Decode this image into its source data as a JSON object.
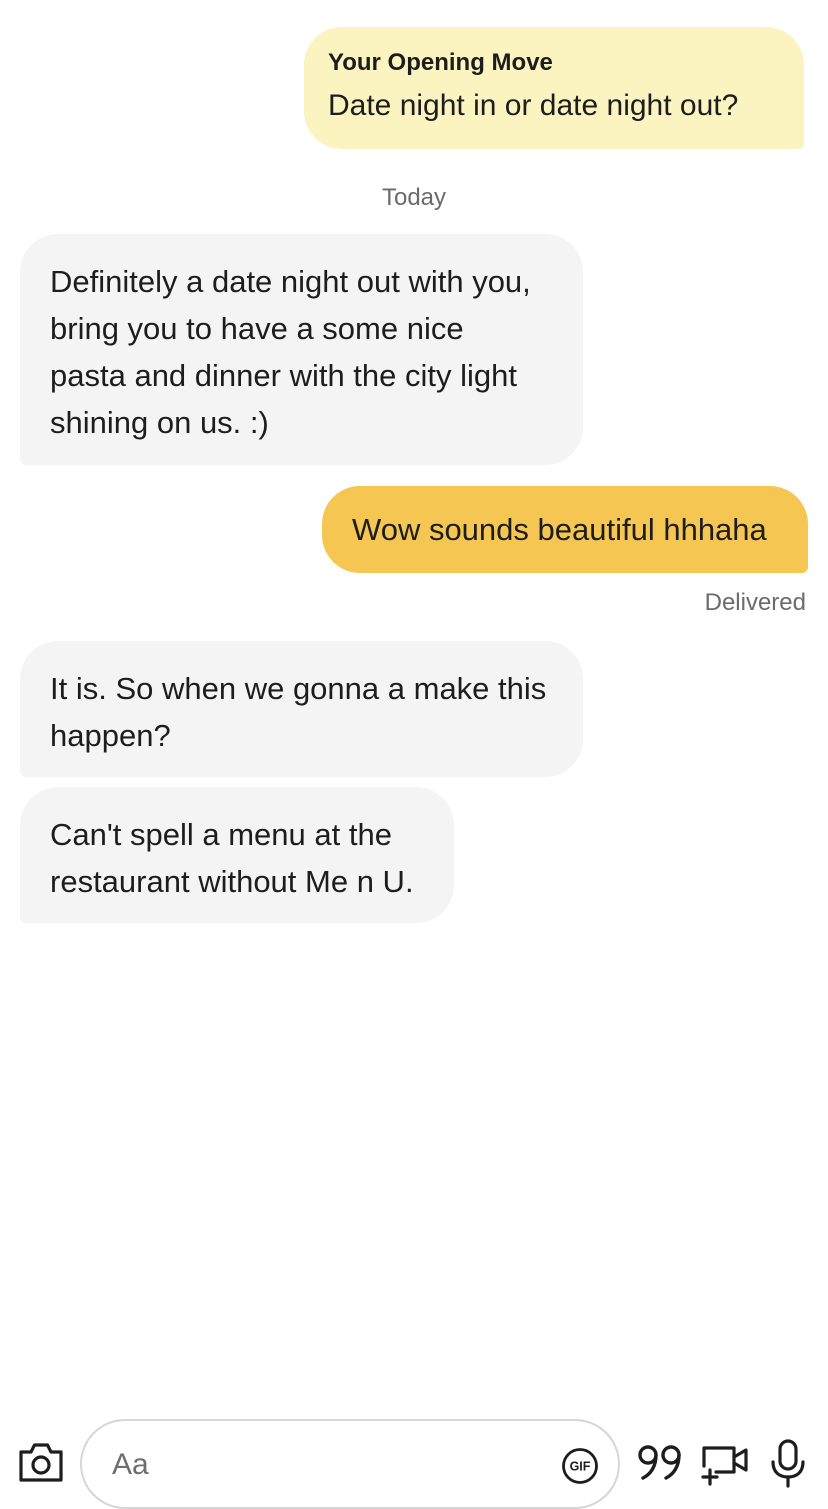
{
  "opening_move": {
    "title": "Your Opening Move",
    "question": "Date night in or date night out?"
  },
  "day_separator": "Today",
  "messages": [
    {
      "direction": "incoming",
      "lines": [
        "Definitely a date night out with you,",
        "bring you to have a some nice",
        "pasta and dinner with the city light",
        "shining on us. :)"
      ]
    },
    {
      "direction": "outgoing",
      "text": "Wow sounds beautiful hhhaha",
      "status": "Delivered"
    },
    {
      "direction": "incoming",
      "lines": [
        "It is. So when we gonna a make this",
        "happen?"
      ]
    },
    {
      "direction": "incoming",
      "lines": [
        "Can't spell a menu at the",
        "restaurant without Me n U."
      ]
    }
  ],
  "composer": {
    "placeholder": "Aa",
    "gif_label": "GIF",
    "icons": [
      "camera-icon",
      "gif-icon",
      "quote-icon",
      "video-call-icon",
      "microphone-icon"
    ]
  },
  "colors": {
    "opening_move_bg": "#fbf3c0",
    "outgoing_bg": "#f5c651",
    "incoming_bg": "#f4f4f4",
    "meta_text": "#6b6b6b"
  }
}
